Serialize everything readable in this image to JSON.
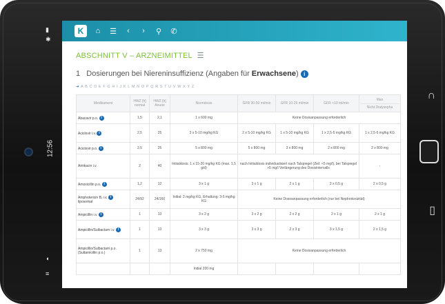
{
  "status": {
    "clock": "12:56"
  },
  "toolbar": {
    "logo": "K",
    "icons": [
      "home-icon",
      "list-icon",
      "back-icon",
      "forward-icon",
      "search-icon",
      "phone-icon"
    ]
  },
  "section": {
    "title": "ABSCHNITT V – ARZNEIMITTEL"
  },
  "heading": {
    "number": "1",
    "text": "Dosierungen bei Niereninsuffizienz (Angaben für ",
    "bold": "Erwachsene",
    "end": ")"
  },
  "alphabet": {
    "arrow": "➜",
    "letters": "A B C D E F G H I J K L M N O P Q R S T U V W X Y Z"
  },
  "table": {
    "headers": [
      "Medikament",
      "HWZ [h] normal",
      "HWZ [h] Anurie",
      "Normdosis",
      "GFR 30-50 ml/min",
      "GFR 10-29 ml/min",
      "GFR <10 ml/min",
      "Man",
      "Nicht Dialysepha"
    ],
    "rows": [
      {
        "name": "Abacavir p.o.",
        "info": true,
        "hn": "1,5",
        "ha": "2,1",
        "norm": "1 x 600 mg",
        "span": "Keine Dosisanpassung erforderlich",
        "h": "r1"
      },
      {
        "name": "Aciclovir i.v.",
        "info": true,
        "hn": "2,5",
        "ha": "25",
        "norm": "3 x 5-10 mg/kg KG",
        "g1": "2 x 5-10 mg/kg KG",
        "g2": "1 x 5-10 mg/kg KG",
        "g3": "1 x 2,5-5 mg/kg KG",
        "g4": "1 x 2,5-5 mg/kg KG",
        "h": "r2"
      },
      {
        "name": "Aciclovir p.o.",
        "info": true,
        "hn": "2,5",
        "ha": "25",
        "norm": "5 x 800 mg",
        "g1": "5 x 800 mg",
        "g2": "3 x 800 mg",
        "g3": "2 x 800 mg",
        "g4": "2 x 800 mg",
        "h": "r1"
      },
      {
        "name": "Amikacin i.v.",
        "info": false,
        "hn": "2",
        "ha": "40",
        "norm": "Initialdosis: 1 x 15-20 mg/kg KG (max. 1,5 g/d)",
        "span3": "nach Initialdosis individualisiert nach Talspiegel (Ziel: <5 mg/l), bei Talspiegel >5 mg/l Verlängerung des Dosisintervalls",
        "g4": "-",
        "h": "r3"
      },
      {
        "name": "Amoxicillin p.o.",
        "info": true,
        "hn": "1,2",
        "ha": "12",
        "norm": "3 x 1 g",
        "g1": "3 x 1 g",
        "g2": "2 x 1 g",
        "g3": "2 x 0,5 g",
        "g4": "2 x 0,5 g",
        "h": "r1"
      },
      {
        "name": "Amphotericin B, i.v.",
        "name2": "liposomal",
        "info": true,
        "hn": "24/92",
        "ha": "24/160",
        "norm": "Initial: 3 mg/kg KG, Erhaltung: 3-5 mg/kg KG",
        "span": "Keine Dosisanpassung erforderlich (nur bei Nephrotoxizität)",
        "h": "r2"
      },
      {
        "name": "Ampicillin i.v.",
        "info": true,
        "hn": "1",
        "ha": "13",
        "norm": "3 x 2 g",
        "g1": "3 x 2 g",
        "g2": "2 x 2 g",
        "g3": "2 x 1 g",
        "g4": "2 x 1 g",
        "h": "r1"
      },
      {
        "name": "Ampicillin/Sulbactam i.v.",
        "info": true,
        "hn": "1",
        "ha": "13",
        "norm": "3 x 3 g",
        "g1": "3 x 3 g",
        "g2": "2 x 3 g",
        "g3": "3 x 1,5 g",
        "g4": "2 x 1,5 g",
        "h": "r2"
      },
      {
        "name": "Ampicillin/Sulbactam p.o. (Sultamicillin p.o.)",
        "info": false,
        "hn": "1",
        "ha": "13",
        "norm": "2 x 750 mg",
        "span": "Keine Dosisanpassung erforderlich",
        "h": "r3"
      },
      {
        "name": "",
        "info": false,
        "hn": "",
        "ha": "",
        "norm": "Initial 200 mg",
        "h": "r1"
      }
    ]
  }
}
